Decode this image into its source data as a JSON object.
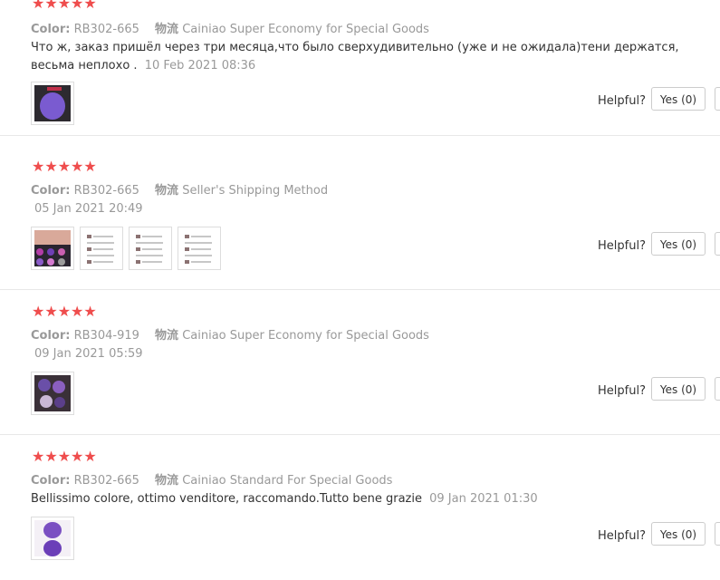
{
  "reviews": [
    {
      "stars": "★★★★★",
      "color_label": "Color:",
      "color_value": "RB302-665",
      "shipping_label": "物流",
      "shipping_value": "Cainiao Super Economy for Special Goods",
      "text": "Что ж, заказ пришёл через три месяца,что было сверхудивительно (уже и не ожидала)тени держатся, весьма неплохо .",
      "date": "10 Feb 2021 08:36",
      "helpful": "Helpful?",
      "yes": "Yes (0)"
    },
    {
      "stars": "★★★★★",
      "color_label": "Color:",
      "color_value": "RB302-665",
      "shipping_label": "物流",
      "shipping_value": "Seller's Shipping Method",
      "text": "",
      "date": "05 Jan 2021 20:49",
      "helpful": "Helpful?",
      "yes": "Yes (0)"
    },
    {
      "stars": "★★★★★",
      "color_label": "Color:",
      "color_value": "RB304-919",
      "shipping_label": "物流",
      "shipping_value": "Cainiao Super Economy for Special Goods",
      "text": "",
      "date": "09 Jan 2021 05:59",
      "helpful": "Helpful?",
      "yes": "Yes (0)"
    },
    {
      "stars": "★★★★★",
      "color_label": "Color:",
      "color_value": "RB302-665",
      "shipping_label": "物流",
      "shipping_value": "Cainiao Standard For Special Goods",
      "text": "Bellissimo colore, ottimo venditore, raccomando.Tutto bene grazie",
      "date": "09 Jan 2021 01:30",
      "helpful": "Helpful?",
      "yes": "Yes (0)"
    }
  ]
}
